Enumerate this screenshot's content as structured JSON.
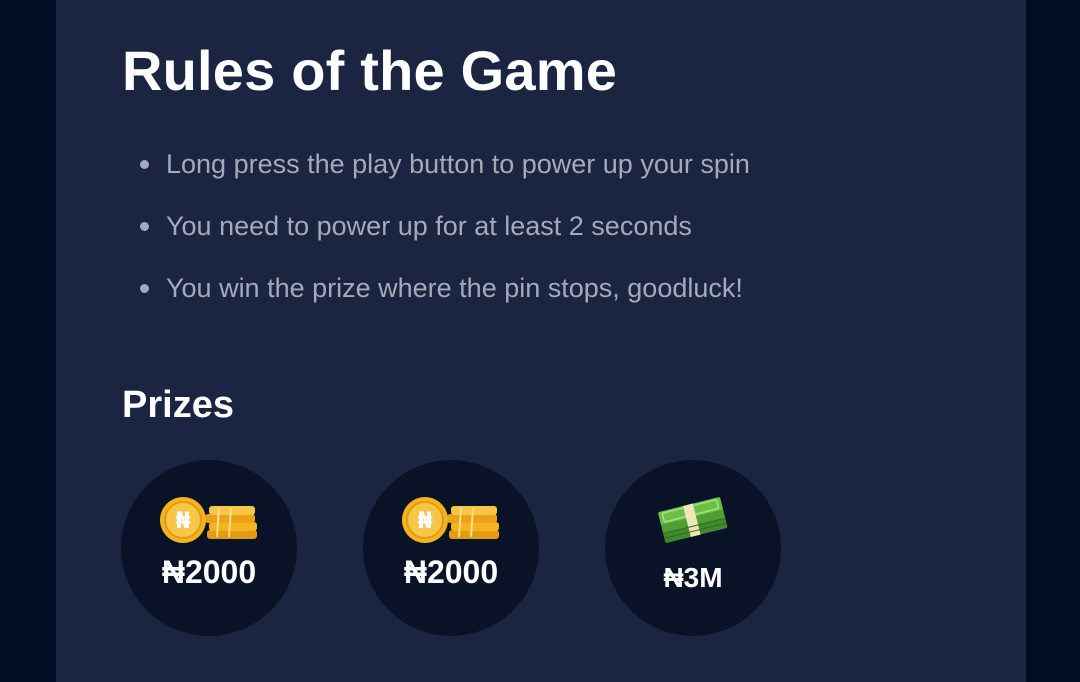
{
  "rules": {
    "title": "Rules of the Game",
    "items": [
      "Long press the play button to power up your spin",
      "You need to power up for at least 2 seconds",
      "You win the prize where the pin stops, goodluck!"
    ]
  },
  "prizes": {
    "heading": "Prizes",
    "items": [
      {
        "icon": "coins-icon",
        "amount": "₦2000"
      },
      {
        "icon": "coins-icon",
        "amount": "₦2000"
      },
      {
        "icon": "cash-stack-icon",
        "amount": "₦3M"
      }
    ]
  },
  "colors": {
    "page_background": "#000d24",
    "panel_background": "#1b2440",
    "prize_circle": "#0a1228",
    "heading_text": "#ffffff",
    "rule_text": "#a4aab8",
    "coin_gold": "#f5b321",
    "cash_green": "#5fae3c"
  }
}
